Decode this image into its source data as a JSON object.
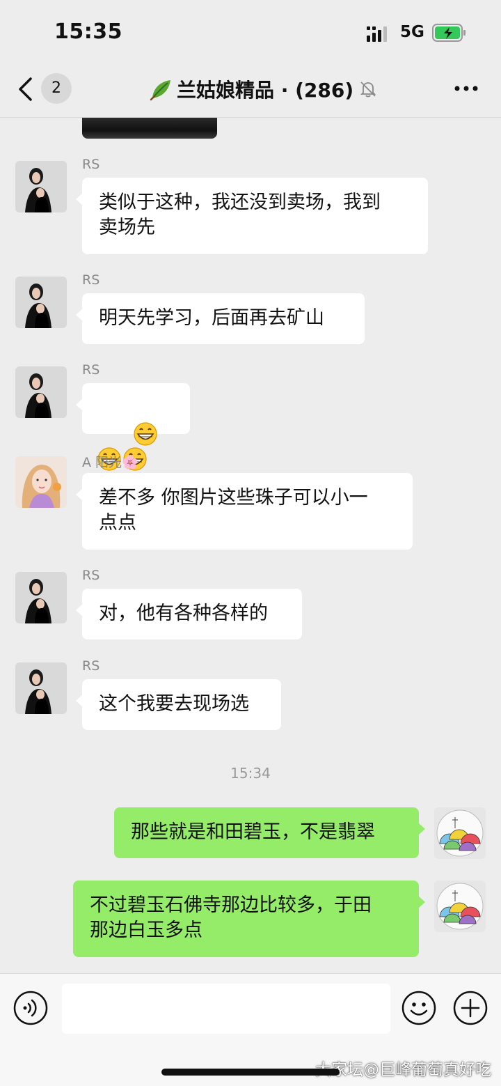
{
  "status_bar": {
    "time": "15:35",
    "network": "5G"
  },
  "header": {
    "back_count": "2",
    "title": "兰姑娘精品 · (286)"
  },
  "messages": [
    {
      "sender": "RS",
      "text": "类似于这种，我还没到卖场，我到\n卖场先"
    },
    {
      "sender": "RS",
      "text": "明天先学习，后面再去矿山"
    },
    {
      "sender": "RS",
      "emoji_count": 3,
      "emoji": "grinning-face-icon"
    },
    {
      "sender": "A 阳光🌸",
      "text": "差不多 你图片这些珠子可以小一\n点点"
    },
    {
      "sender": "RS",
      "text": "对，他有各种各样的"
    },
    {
      "sender": "RS",
      "text": "这个我要去现场选"
    }
  ],
  "timestamp": "15:34",
  "my_messages": [
    {
      "text": "那些就是和田碧玉，不是翡翠"
    },
    {
      "text": "不过碧玉石佛寺那边比较多，于田\n那边白玉多点"
    }
  ],
  "input": {
    "placeholder": ""
  },
  "watermark": "大家坛@巨峰葡萄真好吃",
  "colors": {
    "background": "#ededed",
    "my_bubble": "#95ec69",
    "their_bubble": "#ffffff"
  }
}
